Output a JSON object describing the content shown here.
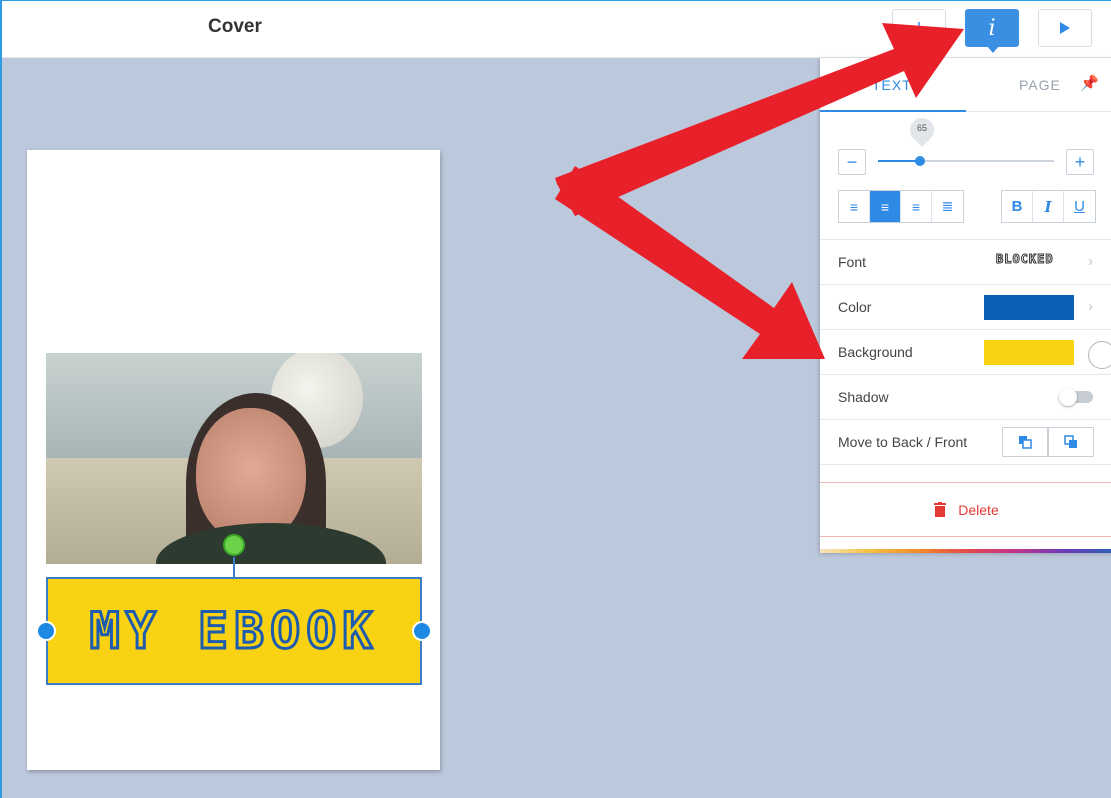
{
  "header": {
    "title": "Cover",
    "add_label": "+",
    "info_label": "i"
  },
  "canvas": {
    "banner_text": "MY EBOOK"
  },
  "panel": {
    "tabs": [
      {
        "label": "TEXT"
      },
      {
        "label": "PAGE"
      }
    ],
    "font_size": "65",
    "font_size_fraction": 0.24,
    "minus_label": "−",
    "plus_label": "+",
    "bold_label": "B",
    "italic_label": "I",
    "underline_label": "U",
    "font": {
      "label": "Font",
      "value": "BLOCKED"
    },
    "color": {
      "label": "Color",
      "value": "#0c5fb4"
    },
    "background": {
      "label": "Background",
      "value": "#f9d313"
    },
    "shadow": {
      "label": "Shadow",
      "enabled": false
    },
    "order": {
      "label": "Move to Back / Front"
    },
    "delete_label": "Delete"
  },
  "colors": {
    "accent": "#2f8ae5",
    "annotation_arrow": "#e8202a",
    "delete": "#e53935"
  },
  "icons": [
    "plus-icon",
    "info-icon",
    "play-icon",
    "pin-icon",
    "align-left-icon",
    "align-center-icon",
    "align-right-icon",
    "align-justify-icon",
    "chevron-right-icon",
    "send-back-icon",
    "bring-front-icon",
    "trash-icon"
  ]
}
